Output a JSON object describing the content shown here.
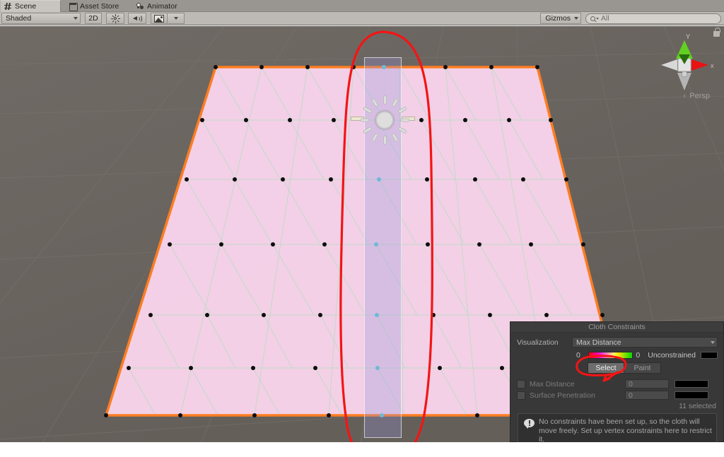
{
  "window": {
    "tabs": [
      {
        "label": "Scene",
        "icon": "grid-hash-icon",
        "active": true
      },
      {
        "label": "Asset Store",
        "icon": "box-icon",
        "active": false
      },
      {
        "label": "Animator",
        "icon": "animator-nodes-icon",
        "active": false
      }
    ]
  },
  "toolbar": {
    "draw_mode": "Shaded",
    "mode_2d": "2D",
    "lighting_icon": "sun-icon",
    "audio_icon": "speaker-icon",
    "fx_icon": "image-fx-icon",
    "fx_caret_icon": "chevron-down-icon",
    "gizmos_label": "Gizmos",
    "gizmos_caret_icon": "chevron-down-icon",
    "search_value": "All",
    "search_placeholder": "All",
    "search_icon": "search-icon",
    "search_filter_caret_icon": "chevron-down-icon"
  },
  "viewport": {
    "background_color": "#6b6560",
    "grid_color": "#7b7570",
    "cloth": {
      "fill_color": "#f9d4ec",
      "wire_color": "#b9dcc4",
      "outline_color": "#ff7d20",
      "vertex_color": "#0d0d0d",
      "selected_vertex_color": "#58c8d8"
    },
    "selection_band": {
      "fill_color": "#9696dc",
      "border_color": "#ffffff"
    },
    "gizmo_icon": "sunburst-move-gizmo-icon",
    "axis_widget": {
      "y_axis_label": "Y",
      "y_axis_color": "#62d022",
      "x_axis_label": "x",
      "x_axis_color": "#e81313",
      "z_axis_color": "#c8c8c8",
      "projection_label": "Persp",
      "projection_caret_icon": "chevron-left-icon",
      "lock_icon": "lock-icon"
    },
    "annotation": {
      "color": "#f41414",
      "shapes": [
        "ellipse-around-selected-column",
        "ellipse-around-select-button",
        "arrow-to-max-distance"
      ]
    }
  },
  "panel": {
    "title": "Cloth Constraints",
    "visualization_label": "Visualization",
    "visualization_value": "Max Distance",
    "visualization_caret_icon": "chevron-down-icon",
    "gradient_min": "0",
    "gradient_max": "0",
    "unconstrained_label": "Unconstrained",
    "unconstrained_swatch_color": "#000000",
    "gradient_colors": [
      "#ff0000",
      "#ff00c8",
      "#fff46b",
      "#00d900"
    ],
    "mode_buttons": [
      {
        "label": "Select",
        "active": true
      },
      {
        "label": "Paint",
        "active": false
      }
    ],
    "constraints": [
      {
        "name": "Max Distance",
        "checked": false,
        "value": "0",
        "bar_color": "#000000"
      },
      {
        "name": "Surface Penetration",
        "checked": false,
        "value": "0",
        "bar_color": "#000000"
      }
    ],
    "selection_count_text": "11 selected",
    "info": {
      "icon": "info-warning-icon",
      "text": "No constraints have been set up, so the cloth will move freely. Set up vertex constraints here to restrict it."
    }
  }
}
